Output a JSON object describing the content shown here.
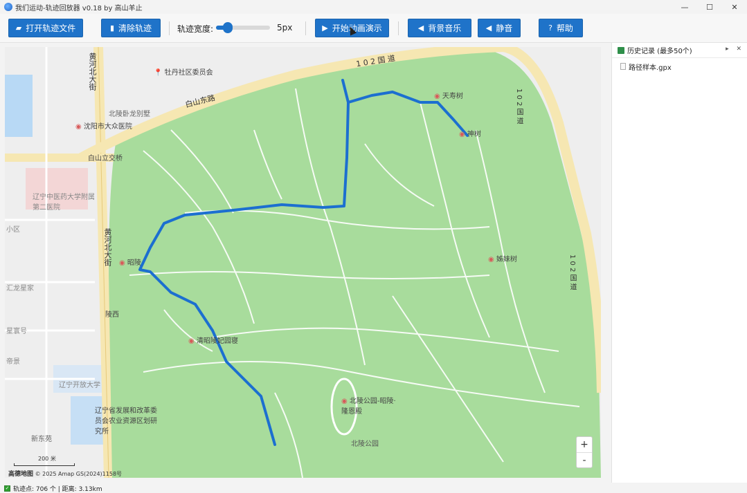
{
  "window": {
    "title": "我们运动-轨迹回放器 v0.18 by 高山羊止",
    "minimize": "—",
    "maximize": "☐",
    "close": "✕"
  },
  "toolbar": {
    "open_label": "打开轨迹文件",
    "clear_label": "清除轨迹",
    "width_label": "轨迹宽度:",
    "width_value": "5px",
    "animate_label": "开始动画演示",
    "music_label": "背景音乐",
    "mute_label": "静音",
    "help_label": "帮助",
    "slider_fraction": 0.22
  },
  "map": {
    "labels": {
      "road_102_top": "1 0 2 国 道",
      "road_102_right_a": "1 0 2 国 道",
      "road_102_right_b": "1 0 2 国 道",
      "baishan_road": "白山东路",
      "huanghe_road": "黄河北大街",
      "huanghe_south": "黄河北大街",
      "mudan": "牡丹社区委员会",
      "hospital": "沈阳市大众医院",
      "interchange": "白山立交桥",
      "beiling_wolong": "北陵卧龙别墅",
      "liaoning_tcm": "辽宁中医药大学附属第二医院",
      "xiaoqu": "小区",
      "tianshou": "天寿树",
      "shenshu": "神树",
      "zhaoling": "昭陵",
      "jiemei": "姊妹树",
      "qingzhao": "清昭陵妃园寝",
      "beiling_park": "北陵公园-昭陵·隆恩殿",
      "beiling_park2": "北陵公园",
      "lingxi": "陵西",
      "liaoning_kaifa": "辽宁开放大学",
      "liaoning_fazhan": "辽宁省发展和改革委员会农业资源区划研究所",
      "xindong": "新东苑",
      "huilong": "汇龙星家",
      "xingjia2": "星寰号",
      "jinghuan": "帝景"
    },
    "zoom_in": "+",
    "zoom_out": "-",
    "scale_text": "200 米",
    "attrib_brand": "高德地图",
    "attrib_text": "© 2025 Amap   GS(2024)1158号"
  },
  "sidebar": {
    "title": "历史记录 (最多50个)",
    "controls": "▸ ✕",
    "items": [
      {
        "name": "路径样本.gpx"
      }
    ]
  },
  "status": {
    "text": "轨迹点: 706 个 | 距离: 3.13km"
  },
  "colors": {
    "button": "#1f73c9",
    "park": "#a8dc9c",
    "road": "#ffffff",
    "highway": "#f6e7b2",
    "track": "#1c6fd0"
  }
}
